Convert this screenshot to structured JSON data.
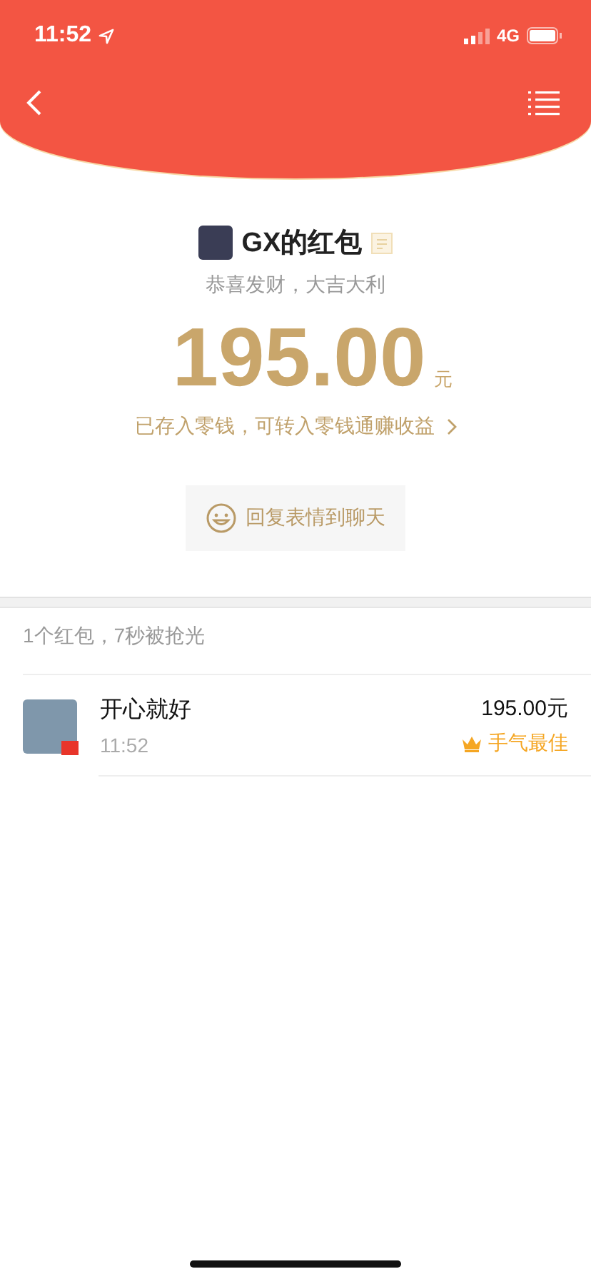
{
  "status_bar": {
    "time": "11:52",
    "network": "4G"
  },
  "envelope": {
    "sender": "GX的红包",
    "blessing": "恭喜发财，大吉大利",
    "amount": "195.00",
    "unit": "元",
    "note": "已存入零钱，可转入零钱通赚收益",
    "reply_button": "回复表情到聊天"
  },
  "summary": "1个红包，7秒被抢光",
  "records": [
    {
      "name": "开心就好",
      "time": "11:52",
      "amount": "195.00元",
      "best": true,
      "best_label": "手气最佳"
    }
  ]
}
